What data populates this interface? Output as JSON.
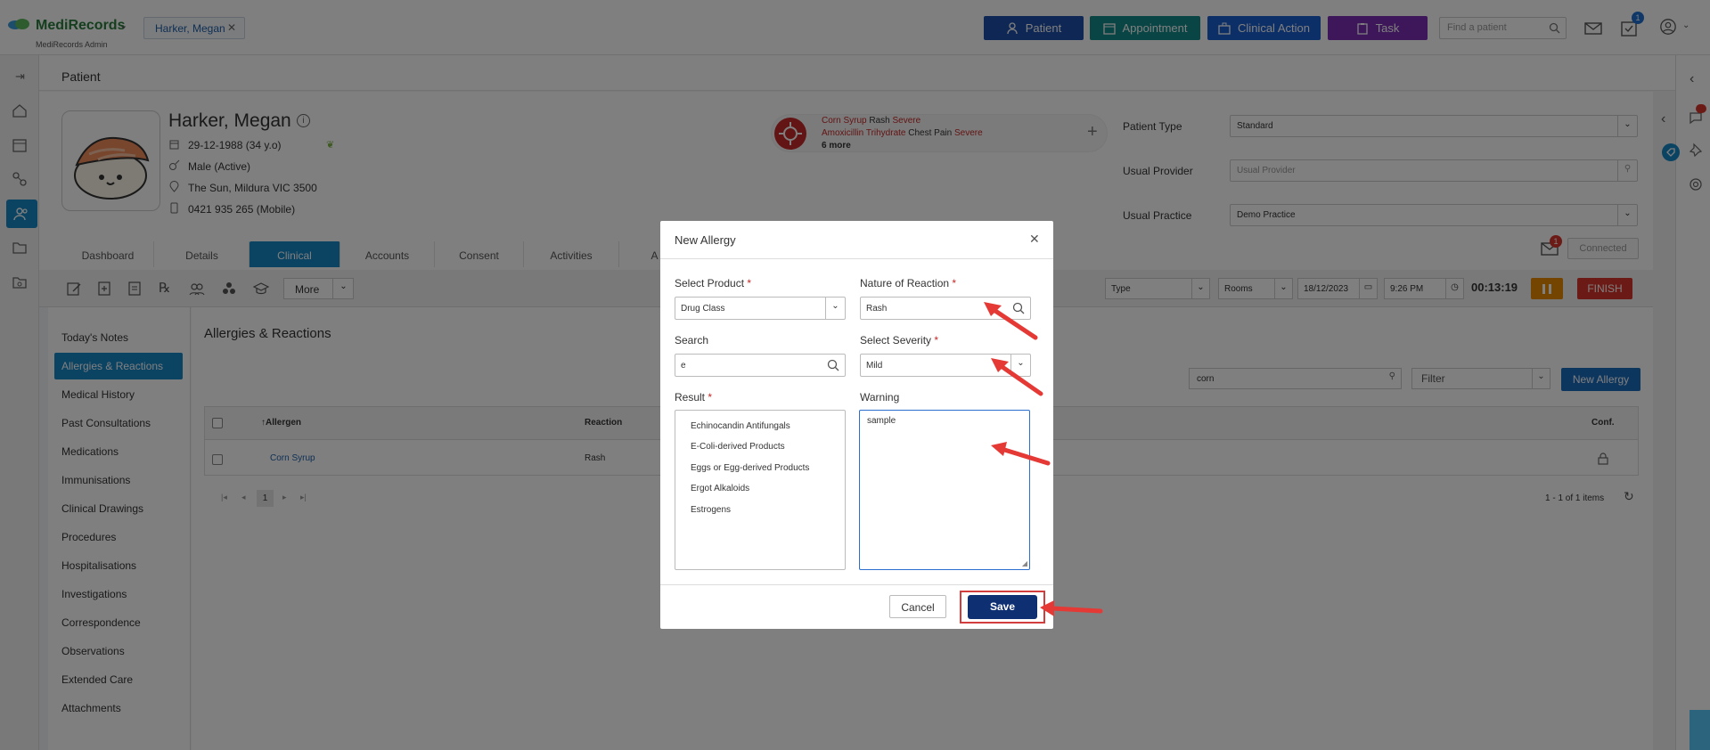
{
  "app": {
    "name": "MediRecords",
    "subtitle": "MediRecords Admin",
    "patient_chip": "Harker, Megan"
  },
  "topbar": {
    "buttons": [
      {
        "label": "Patient",
        "color": "#1e4fa8"
      },
      {
        "label": "Appointment",
        "color": "#138a8a"
      },
      {
        "label": "Clinical Action",
        "color": "#1b5fcf"
      },
      {
        "label": "Task",
        "color": "#7b2fb5"
      }
    ],
    "find_placeholder": "Find a patient",
    "task_badge": "1"
  },
  "page": {
    "title": "Patient"
  },
  "patient": {
    "name": "Harker, Megan",
    "dob": "29-12-1988 (34 y.o)",
    "gender": "Male (Active)",
    "address": "The Sun, Mildura VIC 3500",
    "phone": "0421 935 265 (Mobile)"
  },
  "alerts": {
    "a1_drug": "Corn Syrup",
    "a1_reaction": "Rash",
    "a1_severity": "Severe",
    "a2_drug": "Amoxicillin Trihydrate",
    "a2_reaction": "Chest Pain",
    "a2_severity": "Severe",
    "more": "6 more"
  },
  "patient_fields": {
    "type_label": "Patient Type",
    "type_value": "Standard",
    "provider_label": "Usual Provider",
    "provider_placeholder": "Usual Provider",
    "practice_label": "Usual Practice",
    "practice_value": "Demo Practice",
    "mail_badge": "1",
    "connected": "Connected"
  },
  "tabs": [
    "Dashboard",
    "Details",
    "Clinical",
    "Accounts",
    "Consent",
    "Activities",
    "A"
  ],
  "toolbar": {
    "more": "More",
    "type": "Type",
    "rooms": "Rooms",
    "date": "18/12/2023",
    "time": "9:26 PM",
    "timer": "00:13:19",
    "finish": "FINISH"
  },
  "sidenav": [
    "Today's Notes",
    "Allergies & Reactions",
    "Medical History",
    "Past Consultations",
    "Medications",
    "Immunisations",
    "Clinical Drawings",
    "Procedures",
    "Hospitalisations",
    "Investigations",
    "Correspondence",
    "Observations",
    "Extended Care",
    "Attachments"
  ],
  "allergies": {
    "title": "Allergies & Reactions",
    "search_value": "corn",
    "filter": "Filter",
    "new_button": "New Allergy",
    "col_allergen": "Allergen",
    "col_reaction": "Reaction",
    "col_conf": "Conf.",
    "row_allergen": "Corn Syrup",
    "row_reaction": "Rash",
    "pager_page": "1",
    "pager_info": "1 - 1 of 1 items"
  },
  "modal": {
    "title": "New Allergy",
    "product_label": "Select Product",
    "product_value": "Drug Class",
    "nature_label": "Nature of Reaction",
    "nature_value": "Rash",
    "search_label": "Search",
    "search_value": "e",
    "severity_label": "Select Severity",
    "severity_value": "Mild",
    "result_label": "Result",
    "results": [
      "Echinocandin Antifungals",
      "E-Coli-derived Products",
      "Eggs or Egg-derived Products",
      "Ergot Alkaloids",
      "Estrogens"
    ],
    "warning_label": "Warning",
    "warning_value": "sample",
    "cancel": "Cancel",
    "save": "Save"
  }
}
